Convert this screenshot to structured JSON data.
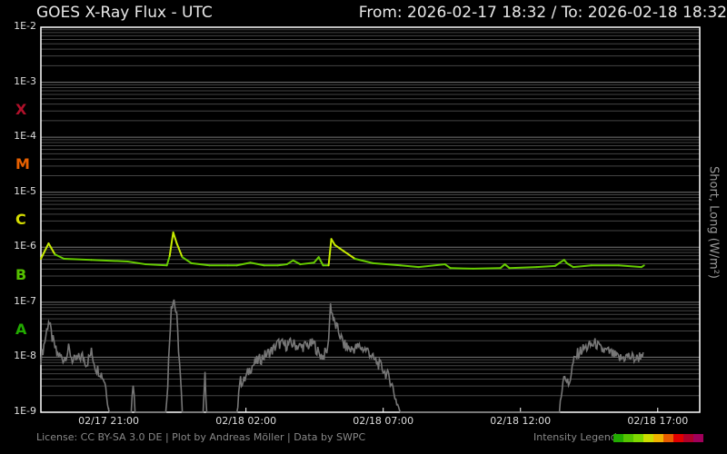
{
  "header": {
    "title": "GOES X-Ray Flux - UTC",
    "range": "From: 2026-02-17 18:32  /  To: 2026-02-18 18:32"
  },
  "footer": {
    "license": "License: CC BY-SA 3.0 DE | Plot by Andreas Möller | Data by SWPC",
    "legend_label": "Intensity Legend"
  },
  "legend_colors": [
    "#22aa00",
    "#55c400",
    "#7fd800",
    "#ccdd00",
    "#f0b400",
    "#e85c00",
    "#e00000",
    "#b0002a",
    "#a0005a"
  ],
  "classes": [
    {
      "label": "X",
      "color": "#b0102a",
      "log": -3.5
    },
    {
      "label": "M",
      "color": "#e86000",
      "log": -4.5
    },
    {
      "label": "C",
      "color": "#d4dc00",
      "log": -5.5
    },
    {
      "label": "B",
      "color": "#55c000",
      "log": -6.5
    },
    {
      "label": "A",
      "color": "#22aa00",
      "log": -7.5
    }
  ],
  "chart_data": {
    "type": "line",
    "title": "GOES X-Ray Flux - UTC",
    "ylabel": "Short, Long (W/m²)",
    "yscale": "log",
    "ylim_log10": [
      -9,
      -2
    ],
    "ytick_labels": [
      "1E-2",
      "1E-3",
      "1E-4",
      "1E-5",
      "1E-6",
      "1E-7",
      "1E-8",
      "1E-9"
    ],
    "x_unit": "hours since 2026-02-17 18:32 UTC",
    "xlim": [
      0,
      24
    ],
    "xticks": [
      {
        "h": 2.47,
        "label": "02/17 21:00"
      },
      {
        "h": 7.47,
        "label": "02/18 02:00"
      },
      {
        "h": 12.47,
        "label": "02/18 07:00"
      },
      {
        "h": 17.47,
        "label": "02/18 12:00"
      },
      {
        "h": 22.47,
        "label": "02/18 17:00"
      }
    ],
    "series": [
      {
        "name": "Long",
        "color_low": "#66cc00",
        "color_high": "#c8ec00",
        "points": [
          [
            0,
            -6.21
          ],
          [
            0.28,
            -5.93
          ],
          [
            0.51,
            -6.13
          ],
          [
            0.84,
            -6.21
          ],
          [
            1.84,
            -6.23
          ],
          [
            3.16,
            -6.26
          ],
          [
            3.82,
            -6.31
          ],
          [
            4.59,
            -6.33
          ],
          [
            4.69,
            -6.16
          ],
          [
            4.82,
            -5.73
          ],
          [
            4.95,
            -5.93
          ],
          [
            5.15,
            -6.18
          ],
          [
            5.48,
            -6.29
          ],
          [
            6.14,
            -6.33
          ],
          [
            6.81,
            -6.33
          ],
          [
            7.14,
            -6.33
          ],
          [
            7.63,
            -6.28
          ],
          [
            8.13,
            -6.33
          ],
          [
            8.63,
            -6.33
          ],
          [
            8.96,
            -6.31
          ],
          [
            9.19,
            -6.24
          ],
          [
            9.45,
            -6.31
          ],
          [
            9.95,
            -6.28
          ],
          [
            10.12,
            -6.18
          ],
          [
            10.28,
            -6.33
          ],
          [
            10.48,
            -6.33
          ],
          [
            10.58,
            -5.85
          ],
          [
            10.71,
            -5.96
          ],
          [
            10.94,
            -6.04
          ],
          [
            11.44,
            -6.21
          ],
          [
            12.1,
            -6.29
          ],
          [
            13.1,
            -6.33
          ],
          [
            13.76,
            -6.36
          ],
          [
            14.72,
            -6.31
          ],
          [
            14.92,
            -6.38
          ],
          [
            15.75,
            -6.39
          ],
          [
            16.74,
            -6.38
          ],
          [
            16.9,
            -6.31
          ],
          [
            17.07,
            -6.38
          ],
          [
            18.06,
            -6.36
          ],
          [
            18.73,
            -6.34
          ],
          [
            19.06,
            -6.23
          ],
          [
            19.16,
            -6.29
          ],
          [
            19.39,
            -6.36
          ],
          [
            20.05,
            -6.33
          ],
          [
            21.05,
            -6.33
          ],
          [
            21.88,
            -6.36
          ],
          [
            21.97,
            -6.33
          ]
        ]
      },
      {
        "name": "Short",
        "color": "#777777",
        "points": [
          [
            0,
            -8.03
          ],
          [
            0.18,
            -7.61
          ],
          [
            0.28,
            -7.32
          ],
          [
            0.41,
            -7.65
          ],
          [
            0.58,
            -7.94
          ],
          [
            0.84,
            -8.03
          ],
          [
            1.01,
            -7.86
          ],
          [
            1.18,
            -8.08
          ],
          [
            1.51,
            -7.98
          ],
          [
            1.67,
            -8.11
          ],
          [
            1.84,
            -7.91
          ],
          [
            2.0,
            -8.19
          ],
          [
            2.17,
            -8.27
          ],
          [
            2.33,
            -8.44
          ],
          [
            2.43,
            -8.77
          ],
          [
            2.5,
            -9
          ],
          [
            3.29,
            -9
          ],
          [
            3.36,
            -8.44
          ],
          [
            3.43,
            -9
          ],
          [
            4.55,
            -9
          ],
          [
            4.62,
            -8.44
          ],
          [
            4.75,
            -7.04
          ],
          [
            4.85,
            -6.95
          ],
          [
            4.95,
            -7.28
          ],
          [
            5.05,
            -8.11
          ],
          [
            5.15,
            -9
          ],
          [
            5.91,
            -9
          ],
          [
            5.98,
            -8.36
          ],
          [
            6.04,
            -9
          ],
          [
            7.14,
            -9
          ],
          [
            7.24,
            -8.44
          ],
          [
            7.4,
            -8.44
          ],
          [
            7.63,
            -8.19
          ],
          [
            7.8,
            -8.11
          ],
          [
            8.13,
            -7.98
          ],
          [
            8.46,
            -7.86
          ],
          [
            8.63,
            -7.75
          ],
          [
            8.96,
            -7.78
          ],
          [
            9.12,
            -7.75
          ],
          [
            9.45,
            -7.81
          ],
          [
            9.78,
            -7.78
          ],
          [
            9.95,
            -7.75
          ],
          [
            10.12,
            -7.94
          ],
          [
            10.28,
            -7.98
          ],
          [
            10.45,
            -7.86
          ],
          [
            10.55,
            -7.04
          ],
          [
            10.68,
            -7.37
          ],
          [
            10.84,
            -7.53
          ],
          [
            11.04,
            -7.78
          ],
          [
            11.28,
            -7.86
          ],
          [
            11.6,
            -7.81
          ],
          [
            11.94,
            -7.89
          ],
          [
            12.1,
            -8.03
          ],
          [
            12.43,
            -8.19
          ],
          [
            12.76,
            -8.44
          ],
          [
            12.93,
            -8.77
          ],
          [
            13.1,
            -9
          ],
          [
            18.89,
            -9
          ],
          [
            19.05,
            -8.27
          ],
          [
            19.22,
            -8.52
          ],
          [
            19.39,
            -8.11
          ],
          [
            19.55,
            -7.94
          ],
          [
            19.72,
            -7.86
          ],
          [
            20.05,
            -7.78
          ],
          [
            20.22,
            -7.75
          ],
          [
            20.38,
            -7.86
          ],
          [
            20.71,
            -7.91
          ],
          [
            21.05,
            -8.03
          ],
          [
            21.38,
            -7.98
          ],
          [
            21.71,
            -8.03
          ],
          [
            21.94,
            -7.91
          ]
        ]
      }
    ]
  }
}
